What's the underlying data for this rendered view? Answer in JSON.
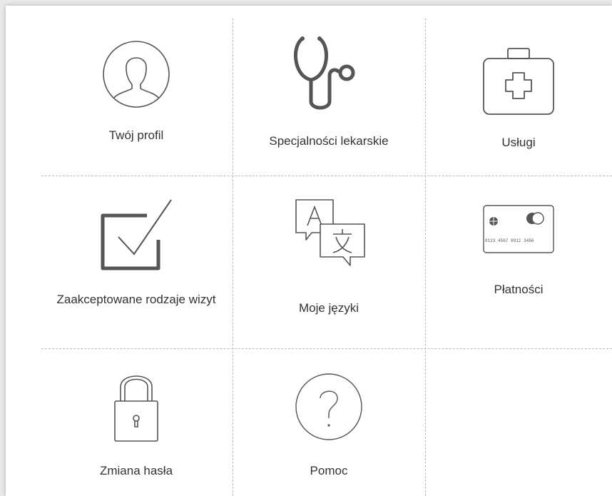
{
  "menu": {
    "items": [
      {
        "id": "profile",
        "label": "Twój profil",
        "icon": "user-avatar-icon"
      },
      {
        "id": "specialties",
        "label": "Specjalności lekarskie",
        "icon": "stethoscope-icon"
      },
      {
        "id": "services",
        "label": "Usługi",
        "icon": "first-aid-kit-icon"
      },
      {
        "id": "visit-types",
        "label": "Zaakceptowane rodzaje wizyt",
        "icon": "checkbox-checked-icon"
      },
      {
        "id": "languages",
        "label": "Moje języki",
        "icon": "translate-icon"
      },
      {
        "id": "payments",
        "label": "Płatności",
        "icon": "credit-card-icon"
      },
      {
        "id": "password",
        "label": "Zmiana hasła",
        "icon": "padlock-icon"
      },
      {
        "id": "help",
        "label": "Pomoc",
        "icon": "question-circle-icon"
      }
    ]
  },
  "card_number_text": "0123 4567 8912 3456",
  "colors": {
    "icon_stroke": "#555555",
    "text": "#333333",
    "divider": "#b9b9b9",
    "background": "#ffffff",
    "page_background": "#e9e9e9"
  }
}
